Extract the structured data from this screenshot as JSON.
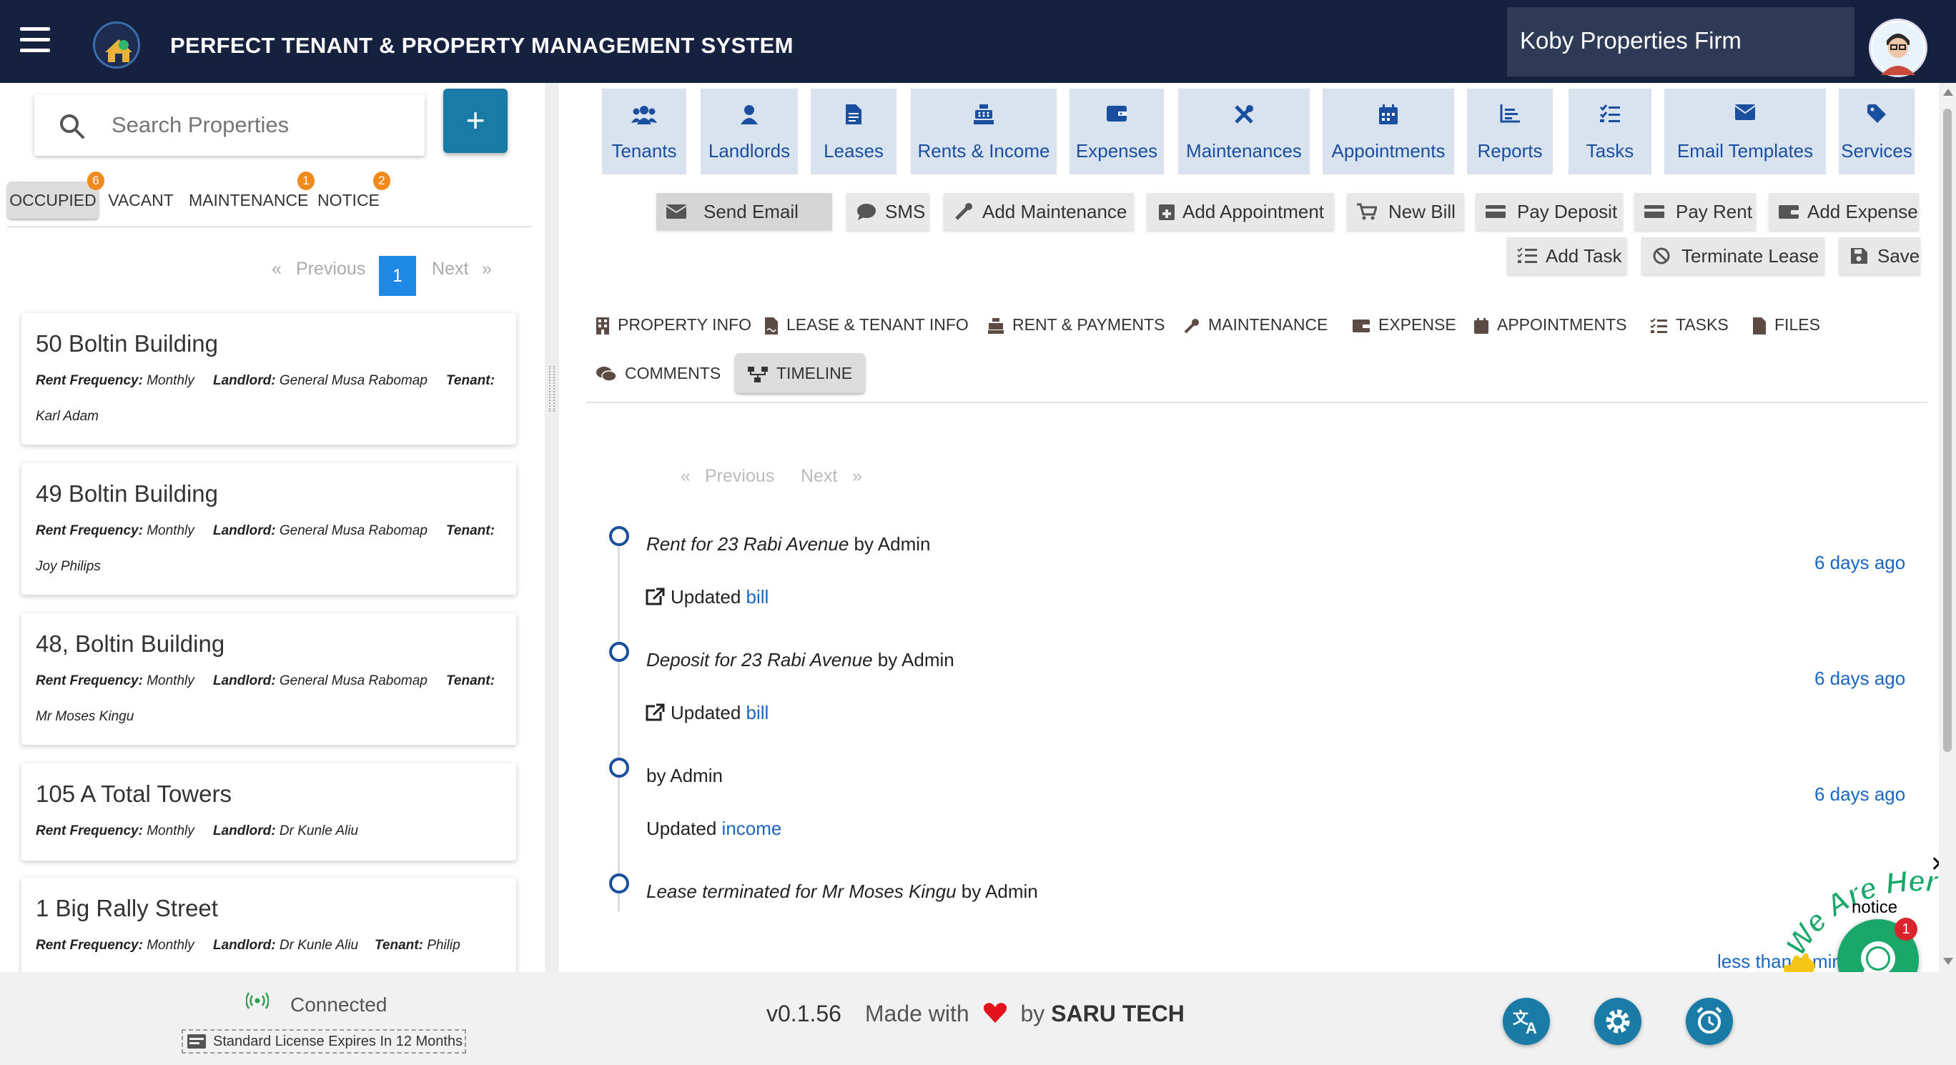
{
  "header": {
    "title": "PERFECT TENANT & PROPERTY MANAGEMENT SYSTEM",
    "firm": "Koby Properties Firm",
    "bg_color": "#15213f"
  },
  "sidebar": {
    "search_placeholder": "Search Properties",
    "add_label": "+",
    "filter_tabs": [
      {
        "label": "OCCUPIED",
        "badge": "6",
        "active": true
      },
      {
        "label": "VACANT",
        "badge": ""
      },
      {
        "label": "MAINTENANCE",
        "badge": "1"
      },
      {
        "label": "NOTICE",
        "badge": "2"
      }
    ],
    "pagination": {
      "prev_arrow": "«",
      "prev": "Previous",
      "page": "1",
      "next": "Next",
      "next_arrow": "»"
    },
    "properties": [
      {
        "title": "50 Boltin Building",
        "freq_label": "Rent Frequency:",
        "freq": "Monthly",
        "landlord_label": "Landlord:",
        "landlord": "General Musa Rabomap",
        "tenant_label": "Tenant:",
        "tenant": "Karl Adam"
      },
      {
        "title": "49 Boltin Building",
        "freq_label": "Rent Frequency:",
        "freq": "Monthly",
        "landlord_label": "Landlord:",
        "landlord": "General Musa Rabomap",
        "tenant_label": "Tenant:",
        "tenant": "Joy Philips"
      },
      {
        "title": "48, Boltin Building",
        "freq_label": "Rent Frequency:",
        "freq": "Monthly",
        "landlord_label": "Landlord:",
        "landlord": "General Musa Rabomap",
        "tenant_label": "Tenant:",
        "tenant": "Mr Moses Kingu"
      },
      {
        "title": "105 A Total Towers",
        "freq_label": "Rent Frequency:",
        "freq": "Monthly",
        "landlord_label": "Landlord:",
        "landlord": "Dr Kunle Aliu"
      },
      {
        "title": "1 Big Rally Street",
        "freq_label": "Rent Frequency:",
        "freq": "Monthly",
        "landlord_label": "Landlord:",
        "landlord": "Dr Kunle Aliu",
        "tenant_label": "Tenant:",
        "tenant": "Philip"
      }
    ]
  },
  "nav": {
    "items": [
      {
        "label": "Tenants",
        "icon": "users-icon"
      },
      {
        "label": "Landlords",
        "icon": "user-icon"
      },
      {
        "label": "Leases",
        "icon": "file-icon"
      },
      {
        "label": "Rents & Income",
        "icon": "cash-register-icon"
      },
      {
        "label": "Expenses",
        "icon": "wallet-icon"
      },
      {
        "label": "Maintenances",
        "icon": "tools-icon"
      },
      {
        "label": "Appointments",
        "icon": "calendar-icon"
      },
      {
        "label": "Reports",
        "icon": "chart-icon"
      },
      {
        "label": "Tasks",
        "icon": "tasks-icon"
      },
      {
        "label": "Email Templates",
        "icon": "envelope-icon"
      },
      {
        "label": "Services",
        "icon": "tag-icon"
      }
    ]
  },
  "actions": {
    "send_email": "Send Email",
    "sms": "SMS",
    "add_maintenance": "Add Maintenance",
    "add_appointment": "Add Appointment",
    "new_bill": "New Bill",
    "pay_deposit": "Pay Deposit",
    "pay_rent": "Pay Rent",
    "add_expense": "Add Expense",
    "add_task": "Add Task",
    "terminate_lease": "Terminate Lease",
    "save": "Save"
  },
  "section_tabs": {
    "property_info": "PROPERTY INFO",
    "lease_tenant": "LEASE & TENANT INFO",
    "rent_payments": "RENT & PAYMENTS",
    "maintenance": "MAINTENANCE",
    "expense": "EXPENSE",
    "appointments": "APPOINTMENTS",
    "tasks": "TASKS",
    "files": "FILES",
    "comments": "COMMENTS",
    "timeline": "TIMELINE"
  },
  "timeline": {
    "pagination": {
      "prev_arrow": "«",
      "prev": "Previous",
      "next": "Next",
      "next_arrow": "»"
    },
    "entries": [
      {
        "title": "Rent for 23 Rabi Avenue",
        "by": "by Admin",
        "updated": "Updated",
        "link": "bill",
        "time": "6 days ago"
      },
      {
        "title": "Deposit for 23 Rabi Avenue",
        "by": "by Admin",
        "updated": "Updated",
        "link": "bill",
        "time": "6 days ago"
      },
      {
        "title": "",
        "by": "by Admin",
        "updated": "Updated",
        "link": "income",
        "time": "6 days ago"
      },
      {
        "title": "Lease terminated for Mr Moses Kingu",
        "by": "by Admin",
        "updated": "",
        "link": "",
        "time": "less than a minute"
      }
    ]
  },
  "chat": {
    "tagline": "We Are Here!",
    "notice": "notice",
    "badge": "1",
    "close": "✕"
  },
  "footer": {
    "status": "Connected",
    "license": "Standard License Expires In 12 Months",
    "version": "v0.1.56",
    "made_with": "Made with",
    "by": "by",
    "company": "SARU TECH"
  }
}
